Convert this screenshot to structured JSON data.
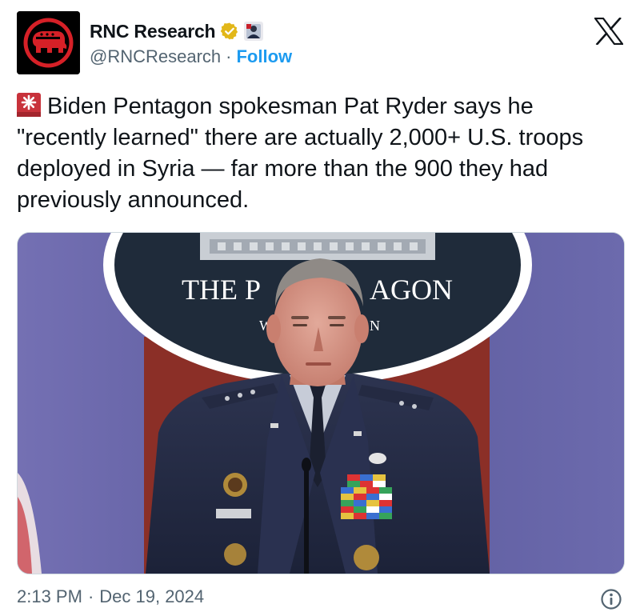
{
  "header": {
    "display_name": "RNC Research",
    "handle": "@RNCResearch",
    "separator": "·",
    "follow_label": "Follow"
  },
  "post": {
    "text": "Biden Pentagon spokesman Pat Ryder says he \"recently learned\" there are actually 2,000+ U.S. troops deployed in Syria — far more than the 900 they had previously announced.",
    "leading_emoji": "siren-icon"
  },
  "media": {
    "seal_text": "THE PENTAGON",
    "seal_text_partial_left": "THE P",
    "seal_text_partial_right": "AGON",
    "seal_subtext_left": "W",
    "seal_subtext_right": "N"
  },
  "footer": {
    "time": "2:13 PM",
    "separator": "·",
    "date": "Dec 19, 2024"
  },
  "colors": {
    "link": "#1d9bf0",
    "secondary_text": "#536471",
    "verified_gold": "#e2b719",
    "brand_red": "#d62027"
  }
}
